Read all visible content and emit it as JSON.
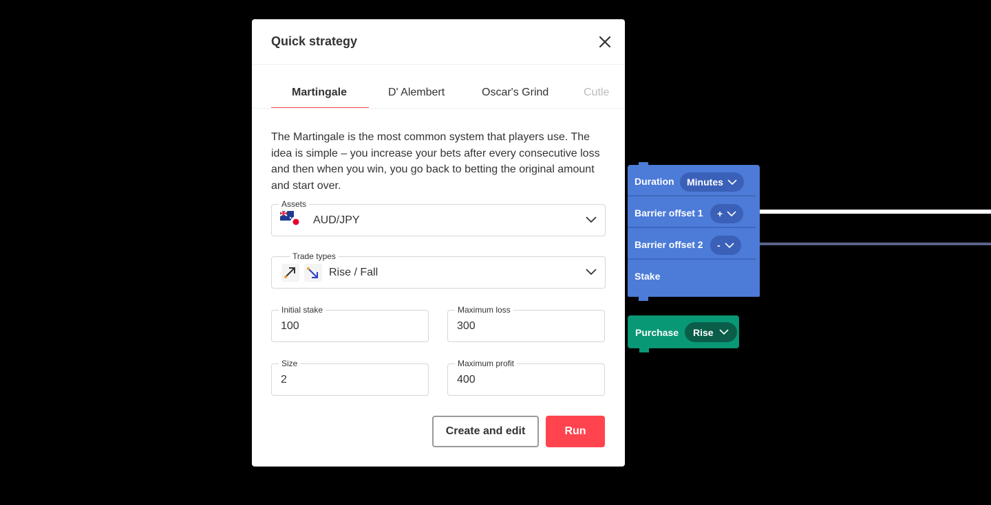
{
  "modal": {
    "title": "Quick strategy",
    "close_icon": "close-icon"
  },
  "tabs": [
    {
      "label": "Martingale",
      "active": true
    },
    {
      "label": "D' Alembert",
      "active": false
    },
    {
      "label": "Oscar's Grind",
      "active": false
    },
    {
      "label": "Cutle",
      "active": false
    }
  ],
  "description": "The Martingale is the most common system that players use. The idea is simple – you increase your bets after every consecutive loss and then when you win, you go back to betting the original amount and start over.",
  "form": {
    "assets": {
      "label": "Assets",
      "value": "AUD/JPY",
      "icon": "aud-jpy-flag-icon"
    },
    "trade_types": {
      "label": "Trade types",
      "value": "Rise / Fall",
      "icons": [
        "rise-icon",
        "fall-icon"
      ]
    },
    "initial_stake": {
      "label": "Initial stake",
      "value": "100"
    },
    "maximum_loss": {
      "label": "Maximum loss",
      "value": "300"
    },
    "size": {
      "label": "Size",
      "value": "2"
    },
    "maximum_profit": {
      "label": "Maximum profit",
      "value": "400"
    }
  },
  "buttons": {
    "create_and_edit": "Create and edit",
    "run": "Run"
  },
  "blocks": {
    "duration": {
      "label": "Duration",
      "dropdown": "Minutes"
    },
    "barrier_offset_1": {
      "label": "Barrier offset 1",
      "dropdown": "+"
    },
    "barrier_offset_2": {
      "label": "Barrier offset 2",
      "dropdown": "-"
    },
    "stake": {
      "label": "Stake"
    },
    "purchase": {
      "label": "Purchase",
      "dropdown": "Rise"
    }
  },
  "colors": {
    "accent": "#ff444f",
    "block_blue": "#4c7bd8",
    "block_green": "#089876",
    "background": "#000000"
  }
}
